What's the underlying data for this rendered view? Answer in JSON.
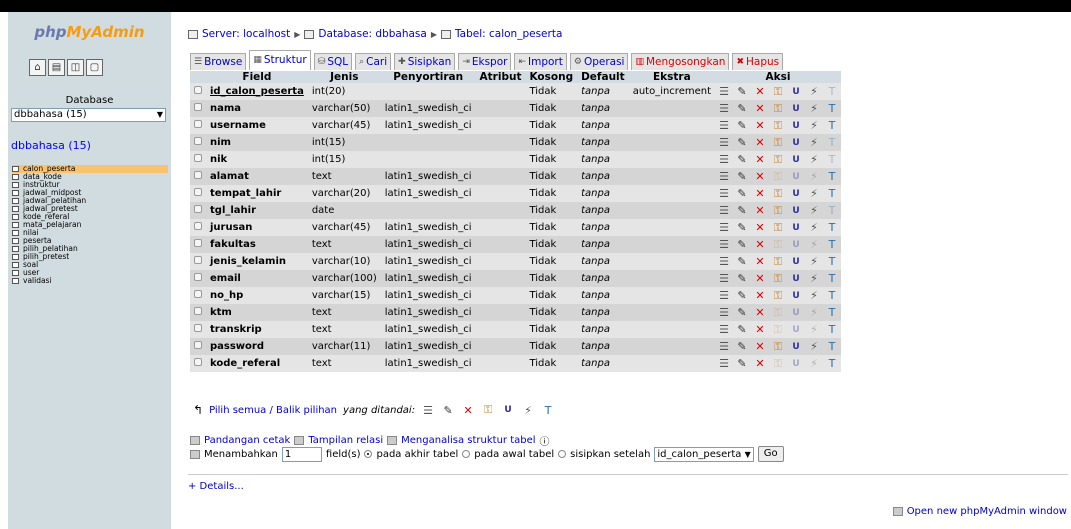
{
  "left": {
    "logo_a": "php",
    "logo_b": "MyAdmin",
    "database_label": "Database",
    "database_select": "dbbahasa (15)",
    "db_title": "dbbahasa (15)",
    "tables": [
      "calon_peserta",
      "data_kode",
      "instruktur",
      "jadwal_midpost",
      "jadwal_pelatihan",
      "jadwal_pretest",
      "kode_referal",
      "mata_pelajaran",
      "nilai",
      "peserta",
      "pilih_pelatihan",
      "pilih_pretest",
      "soal",
      "user",
      "validasi"
    ],
    "selected_table": "calon_peserta"
  },
  "breadcrumb": {
    "server": "Server: localhost",
    "database": "Database: dbbahasa",
    "table": "Tabel: calon_peserta"
  },
  "tabs": [
    {
      "label": "Browse",
      "icon": "browse-icon"
    },
    {
      "label": "Struktur",
      "icon": "structure-icon",
      "active": true
    },
    {
      "label": "SQL",
      "icon": "sql-icon"
    },
    {
      "label": "Cari",
      "icon": "search-icon"
    },
    {
      "label": "Sisipkan",
      "icon": "insert-icon"
    },
    {
      "label": "Ekspor",
      "icon": "export-icon"
    },
    {
      "label": "Import",
      "icon": "import-icon"
    },
    {
      "label": "Operasi",
      "icon": "operations-icon"
    },
    {
      "label": "Mengosongkan",
      "icon": "empty-icon",
      "red": true
    },
    {
      "label": "Hapus",
      "icon": "drop-icon",
      "red": true
    }
  ],
  "columns": [
    "Field",
    "Jenis",
    "Penyortiran",
    "Atribut",
    "Kosong",
    "Default",
    "Ekstra",
    "Aksi"
  ],
  "rows": [
    {
      "field": "id_calon_peserta",
      "type": "int(20)",
      "collation": "",
      "attr": "",
      "null": "Tidak",
      "default": "tanpa",
      "extra": "auto_increment",
      "primary": true
    },
    {
      "field": "nama",
      "type": "varchar(50)",
      "collation": "latin1_swedish_ci",
      "attr": "",
      "null": "Tidak",
      "default": "tanpa",
      "extra": ""
    },
    {
      "field": "username",
      "type": "varchar(45)",
      "collation": "latin1_swedish_ci",
      "attr": "",
      "null": "Tidak",
      "default": "tanpa",
      "extra": ""
    },
    {
      "field": "nim",
      "type": "int(15)",
      "collation": "",
      "attr": "",
      "null": "Tidak",
      "default": "tanpa",
      "extra": ""
    },
    {
      "field": "nik",
      "type": "int(15)",
      "collation": "",
      "attr": "",
      "null": "Tidak",
      "default": "tanpa",
      "extra": ""
    },
    {
      "field": "alamat",
      "type": "text",
      "collation": "latin1_swedish_ci",
      "attr": "",
      "null": "Tidak",
      "default": "tanpa",
      "extra": ""
    },
    {
      "field": "tempat_lahir",
      "type": "varchar(20)",
      "collation": "latin1_swedish_ci",
      "attr": "",
      "null": "Tidak",
      "default": "tanpa",
      "extra": ""
    },
    {
      "field": "tgl_lahir",
      "type": "date",
      "collation": "",
      "attr": "",
      "null": "Tidak",
      "default": "tanpa",
      "extra": ""
    },
    {
      "field": "jurusan",
      "type": "varchar(45)",
      "collation": "latin1_swedish_ci",
      "attr": "",
      "null": "Tidak",
      "default": "tanpa",
      "extra": ""
    },
    {
      "field": "fakultas",
      "type": "text",
      "collation": "latin1_swedish_ci",
      "attr": "",
      "null": "Tidak",
      "default": "tanpa",
      "extra": ""
    },
    {
      "field": "jenis_kelamin",
      "type": "varchar(10)",
      "collation": "latin1_swedish_ci",
      "attr": "",
      "null": "Tidak",
      "default": "tanpa",
      "extra": ""
    },
    {
      "field": "email",
      "type": "varchar(100)",
      "collation": "latin1_swedish_ci",
      "attr": "",
      "null": "Tidak",
      "default": "tanpa",
      "extra": ""
    },
    {
      "field": "no_hp",
      "type": "varchar(15)",
      "collation": "latin1_swedish_ci",
      "attr": "",
      "null": "Tidak",
      "default": "tanpa",
      "extra": ""
    },
    {
      "field": "ktm",
      "type": "text",
      "collation": "latin1_swedish_ci",
      "attr": "",
      "null": "Tidak",
      "default": "tanpa",
      "extra": ""
    },
    {
      "field": "transkrip",
      "type": "text",
      "collation": "latin1_swedish_ci",
      "attr": "",
      "null": "Tidak",
      "default": "tanpa",
      "extra": ""
    },
    {
      "field": "password",
      "type": "varchar(11)",
      "collation": "latin1_swedish_ci",
      "attr": "",
      "null": "Tidak",
      "default": "tanpa",
      "extra": ""
    },
    {
      "field": "kode_referal",
      "type": "text",
      "collation": "latin1_swedish_ci",
      "attr": "",
      "null": "Tidak",
      "default": "tanpa",
      "extra": ""
    }
  ],
  "select_all": {
    "link": "Pilih semua / Balik pilihan",
    "suffix": "yang ditandai:"
  },
  "bottom": {
    "print_view": "Pandangan cetak",
    "relation_view": "Tampilan relasi",
    "analyze": "Menganalisa struktur tabel",
    "add_label": "Menambahkan",
    "add_value": "1",
    "fields_text": "field(s)",
    "opt_end": "pada akhir tabel",
    "opt_begin": "pada awal tabel",
    "opt_after": "sisipkan setelah",
    "after_field": "id_calon_peserta",
    "go": "Go"
  },
  "details": "+ Details...",
  "new_window": "Open new phpMyAdmin window"
}
